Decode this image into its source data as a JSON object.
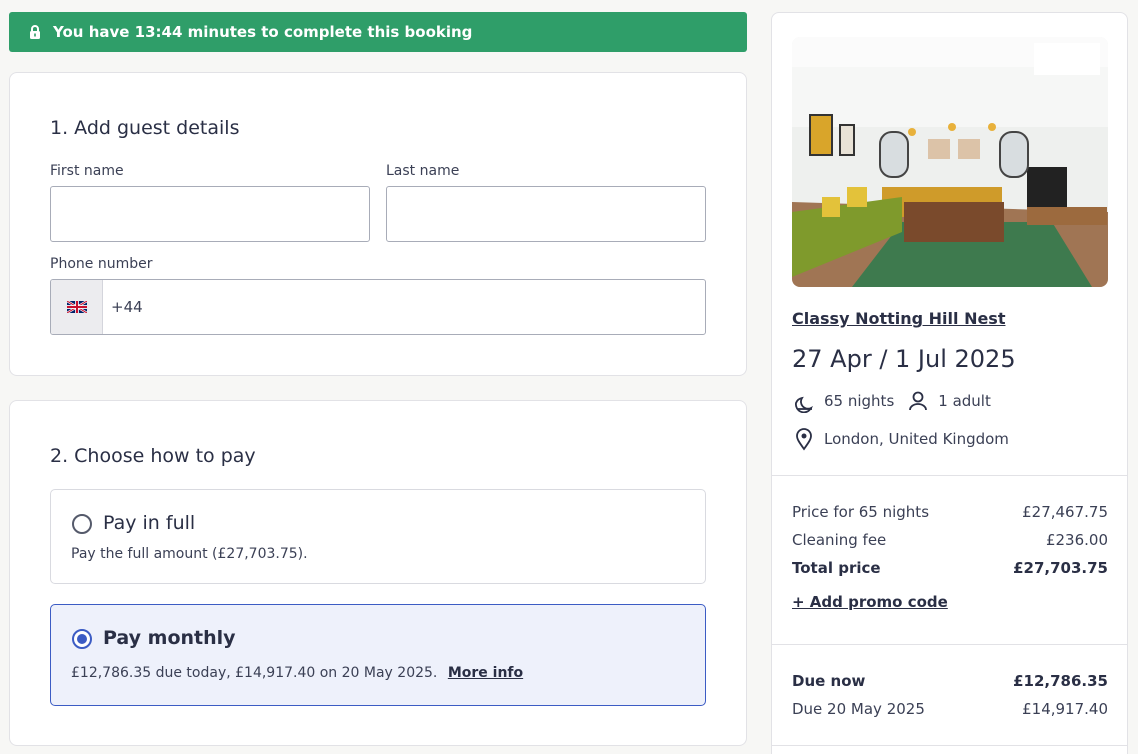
{
  "timer": {
    "text": "You have 13:44 minutes to complete this booking"
  },
  "guest": {
    "title": "1. Add guest details",
    "first_name_label": "First name",
    "last_name_label": "Last name",
    "phone_label": "Phone number",
    "phone_code": "+44",
    "first_name_value": "",
    "last_name_value": ""
  },
  "payment": {
    "title": "2. Choose how to pay",
    "full": {
      "title": "Pay in full",
      "desc": "Pay the full amount (£27,703.75)."
    },
    "monthly": {
      "title": "Pay monthly",
      "desc": "£12,786.35 due today, £14,917.40 on 20 May 2025.",
      "more": "More info"
    }
  },
  "summary": {
    "property_name": "Classy Notting Hill Nest",
    "dates": "27 Apr / 1 Jul 2025",
    "nights": "65 nights",
    "guests": "1 adult",
    "location": "London, United Kingdom",
    "prices": [
      {
        "label": "Price for 65 nights",
        "value": "£27,467.75"
      },
      {
        "label": "Cleaning fee",
        "value": "£236.00"
      },
      {
        "label": "Total price",
        "value": "£27,703.75"
      }
    ],
    "promo": "+ Add promo code",
    "due": [
      {
        "label": "Due now",
        "value": "£12,786.35"
      },
      {
        "label": "Due 20 May 2025",
        "value": "£14,917.40"
      }
    ]
  },
  "colors": {
    "accent": "#3c5cc4",
    "success": "#2f9e69"
  }
}
